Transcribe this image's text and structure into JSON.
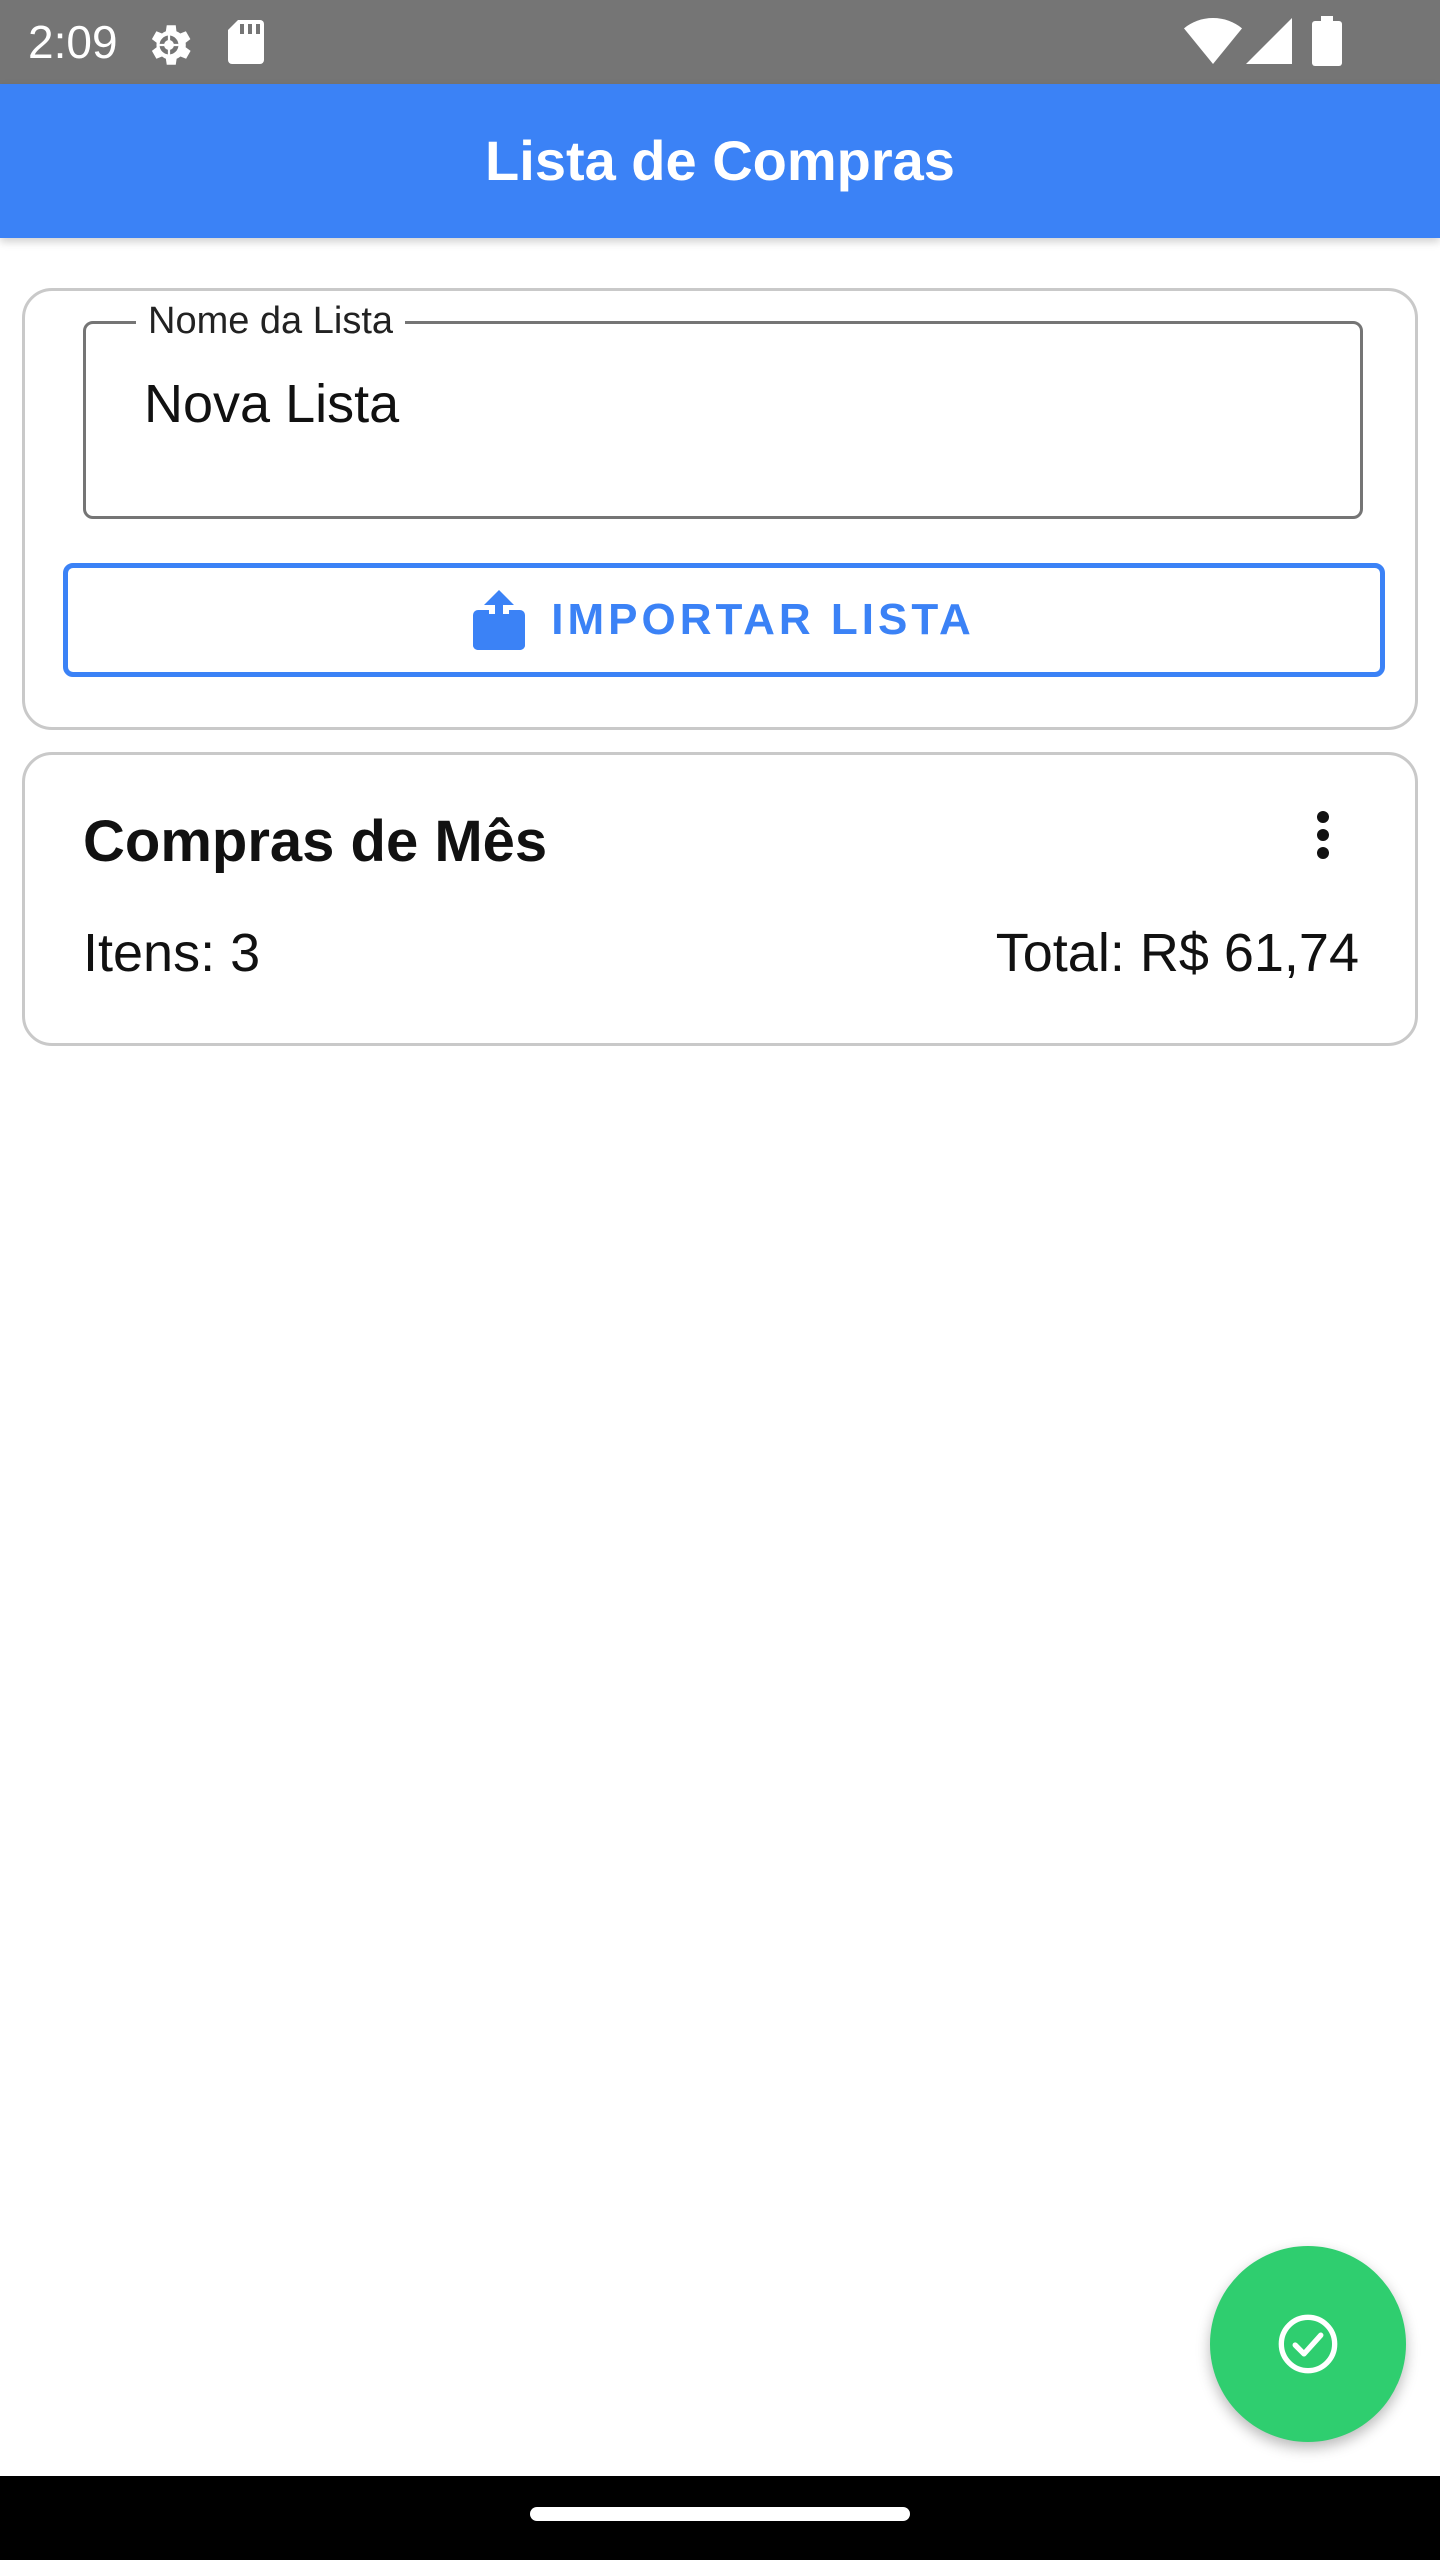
{
  "status_bar": {
    "time": "2:09",
    "icons": [
      "settings-icon",
      "sd-card-icon",
      "wifi-icon",
      "signal-icon",
      "battery-icon"
    ]
  },
  "app_bar": {
    "title": "Lista de Compras",
    "color": "#3b82f6"
  },
  "form": {
    "name_field": {
      "label": "Nome da Lista",
      "value": "Nova Lista"
    },
    "import_button": {
      "label": "IMPORTAR LISTA",
      "icon": "share-icon"
    }
  },
  "lists": [
    {
      "name": "Compras de Mês",
      "items_text": "Itens: 3",
      "total_text": "Total: R$ 61,74",
      "menu_icon": "more-vert-icon"
    }
  ],
  "fab": {
    "icon": "check-circle-icon",
    "color": "#2fce6f"
  },
  "colors": {
    "primary": "#3b82f6",
    "success": "#2fce6f",
    "status_bar": "#757575",
    "nav_bar": "#000000"
  }
}
